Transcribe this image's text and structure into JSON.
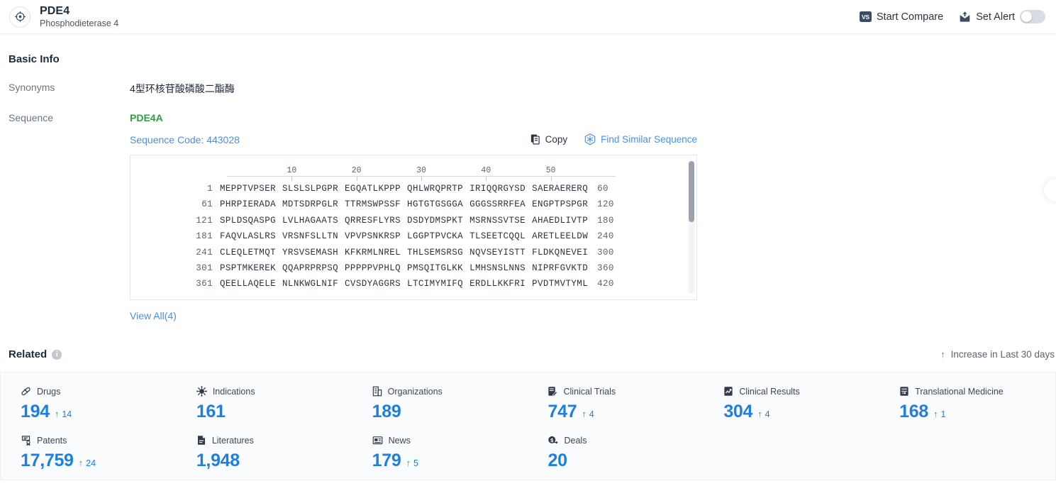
{
  "header": {
    "icon": "target-icon",
    "title": "PDE4",
    "subtitle": "Phosphodieterase 4",
    "start_compare_label": "Start Compare",
    "vs_badge": "VS",
    "set_alert_label": "Set Alert",
    "alert_toggle_state": "off"
  },
  "basic_info": {
    "section_title": "Basic Info",
    "synonyms_label": "Synonyms",
    "synonyms_value": "4型环核苷酸磷酸二酯酶",
    "sequence_label": "Sequence",
    "sequence_name": "PDE4A",
    "sequence_code": "Sequence Code: 443028",
    "copy_label": "Copy",
    "find_similar_label": "Find Similar Sequence",
    "view_all_label": "View All(4)"
  },
  "sequence_viewer": {
    "ruler_ticks": [
      10,
      20,
      30,
      40,
      50
    ],
    "rows": [
      {
        "start": "1",
        "chunks": [
          "MEPPTVPSER",
          "SLSLSLPGPR",
          "EGQATLKPPP",
          "QHLWRQPRTP",
          "IRIQQRGYSD",
          "SAERAERERQ"
        ],
        "end": "60"
      },
      {
        "start": "61",
        "chunks": [
          "PHRPIERADA",
          "MDTSDRPGLR",
          "TTRMSWPSSF",
          "HGTGTGSGGA",
          "GGGSSRRFEA",
          "ENGPTPSPGR"
        ],
        "end": "120"
      },
      {
        "start": "121",
        "chunks": [
          "SPLDSQASPG",
          "LVLHAGAATS",
          "QRRESFLYRS",
          "DSDYDMSPKT",
          "MSRNSSVTSE",
          "AHAEDLIVTP"
        ],
        "end": "180"
      },
      {
        "start": "181",
        "chunks": [
          "FAQVLASLRS",
          "VRSNFSLLTN",
          "VPVPSNKRSP",
          "LGGPTPVCKA",
          "TLSEETCQQL",
          "ARETLEELDW"
        ],
        "end": "240"
      },
      {
        "start": "241",
        "chunks": [
          "CLEQLETMQT",
          "YRSVSEMASH",
          "KFKRMLNREL",
          "THLSEMSRSG",
          "NQVSEYISTT",
          "FLDKQNEVEI"
        ],
        "end": "300"
      },
      {
        "start": "301",
        "chunks": [
          "PSPTMKEREK",
          "QQAPRPRPSQ",
          "PPPPPVPHLQ",
          "PMSQITGLKK",
          "LMHSNSLNNS",
          "NIPRFGVKTD"
        ],
        "end": "360"
      },
      {
        "start": "361",
        "chunks": [
          "QEELLAQELE",
          "NLNKWGLNIF",
          "CVSDYAGGRS",
          "LTCIMYMIFQ",
          "ERDLLKKFRI",
          "PVDTMVTYML"
        ],
        "end": "420"
      }
    ]
  },
  "related": {
    "title": "Related",
    "info_icon_char": "i",
    "increase_note": "Increase in Last 30 days",
    "cards": [
      {
        "icon": "pill-icon",
        "label": "Drugs",
        "value": "194",
        "delta": "14"
      },
      {
        "icon": "virus-icon",
        "label": "Indications",
        "value": "161",
        "delta": ""
      },
      {
        "icon": "building-icon",
        "label": "Organizations",
        "value": "189",
        "delta": ""
      },
      {
        "icon": "clipboard-edit-icon",
        "label": "Clinical Trials",
        "value": "747",
        "delta": "4"
      },
      {
        "icon": "chart-doc-icon",
        "label": "Clinical Results",
        "value": "304",
        "delta": "4"
      },
      {
        "icon": "doc-flow-icon",
        "label": "Translational Medicine",
        "value": "168",
        "delta": "1"
      },
      {
        "icon": "patent-icon",
        "label": "Patents",
        "value": "17,759",
        "delta": "24"
      },
      {
        "icon": "literature-icon",
        "label": "Literatures",
        "value": "1,948",
        "delta": ""
      },
      {
        "icon": "news-icon",
        "label": "News",
        "value": "179",
        "delta": "5"
      },
      {
        "icon": "deal-icon",
        "label": "Deals",
        "value": "20",
        "delta": ""
      }
    ]
  },
  "colors": {
    "accent_blue": "#1e7fe0",
    "link_blue": "#4a90e2",
    "green": "#2eaa4a",
    "sequence_green": "#2e9e43",
    "dark_navy": "#3d4b63"
  }
}
